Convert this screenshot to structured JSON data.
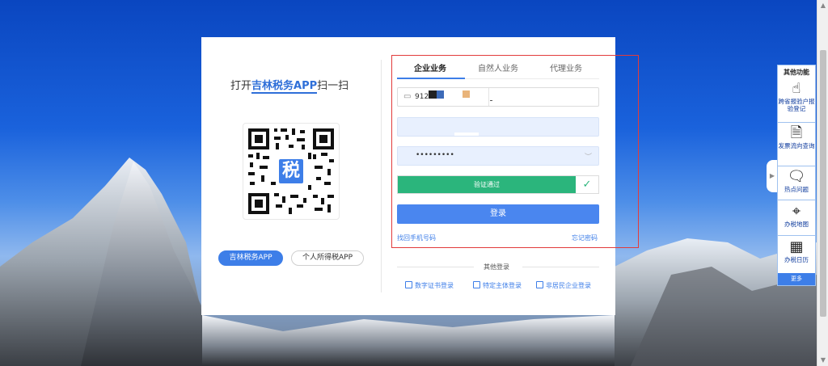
{
  "qr_panel": {
    "title_prefix": "打开",
    "title_app": "吉林税务APP",
    "title_suffix": "扫一扫",
    "qr_logo_char": "税",
    "buttons": [
      {
        "label": "吉林税务APP"
      },
      {
        "label": "个人所得税APP"
      }
    ]
  },
  "login": {
    "tabs": [
      {
        "label": "企业业务"
      },
      {
        "label": "自然人业务"
      },
      {
        "label": "代理业务"
      }
    ],
    "taxid_value": "912",
    "password_value": "•••••••••",
    "verify_text": "验证通过",
    "login_label": "登录",
    "find_account_link": "找回手机号码",
    "forgot_password_link": "忘记密码",
    "other_login_title": "其他登录",
    "other_methods": [
      {
        "label": "数字证书登录"
      },
      {
        "label": "特定主体登录"
      },
      {
        "label": "非居民企业登录"
      }
    ]
  },
  "side_panel": {
    "title": "其他功能",
    "items": [
      {
        "label": "跨省报验户报验登记",
        "icon": "hand-pointer-icon"
      },
      {
        "label": "发票流向查询",
        "icon": "document-icon"
      },
      {
        "label": "热点问题",
        "icon": "chat-bubble-icon"
      },
      {
        "label": "办税地图",
        "icon": "map-pin-icon"
      },
      {
        "label": "办税日历",
        "icon": "calendar-icon"
      }
    ],
    "more_label": "更多"
  },
  "colors": {
    "accent": "#3d7ee8",
    "success": "#2bb57c",
    "highlight_border": "#e23b3b"
  }
}
